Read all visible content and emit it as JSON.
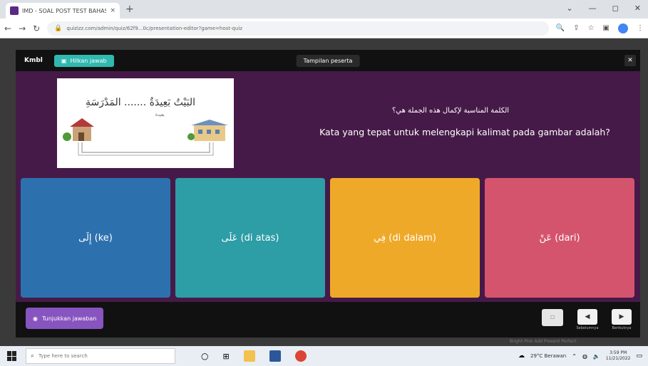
{
  "browser": {
    "tab_title": "IMD - SOAL POST TEST BAHASA",
    "tab_close": "×",
    "new_tab": "+",
    "url": "quizizz.com/admin/quiz/62f9...0c/presentation-editor?game=host-quiz",
    "window_controls": [
      "⌄",
      "—",
      "◻",
      "✕"
    ]
  },
  "app": {
    "back_label": "Kmbl",
    "hide_answers_label": "Hilkan jawab",
    "participant_view_label": "Tampilan peserta",
    "close_label": "✕"
  },
  "question": {
    "image_arabic": "البَيْتُ بَعِيدَةٌ ....... المَدْرَسَةِ",
    "image_small": "بعيدة",
    "text_arabic": "الكلمة المناسبة لإكمال هذه الجملة هي؟",
    "text": "Kata yang tepat untuk melengkapi kalimat pada gambar adalah?"
  },
  "answers": [
    {
      "label": "إِلَى (ke)",
      "color": "#2d70ae"
    },
    {
      "label": "عَلَى (di atas)",
      "color": "#2d9da6"
    },
    {
      "label": "فِي (di dalam)",
      "color": "#efa929"
    },
    {
      "label": "عَنْ (dari)",
      "color": "#d5546d"
    }
  ],
  "bottom": {
    "show_answer_label": "Tunjukkan jawaban",
    "prev_label": "Sebelumnya",
    "next_label": "Berikutnya",
    "under_text": "Bright Pink Add Present Perfect"
  },
  "taskbar": {
    "search_placeholder": "Type here to search",
    "weather": "29°C Berawan",
    "time": "3:59 PM",
    "date": "11/21/2022"
  },
  "colors": {
    "stage_bg": "#461a48",
    "accent_teal": "#30b9b0",
    "accent_purple": "#8854c0"
  }
}
